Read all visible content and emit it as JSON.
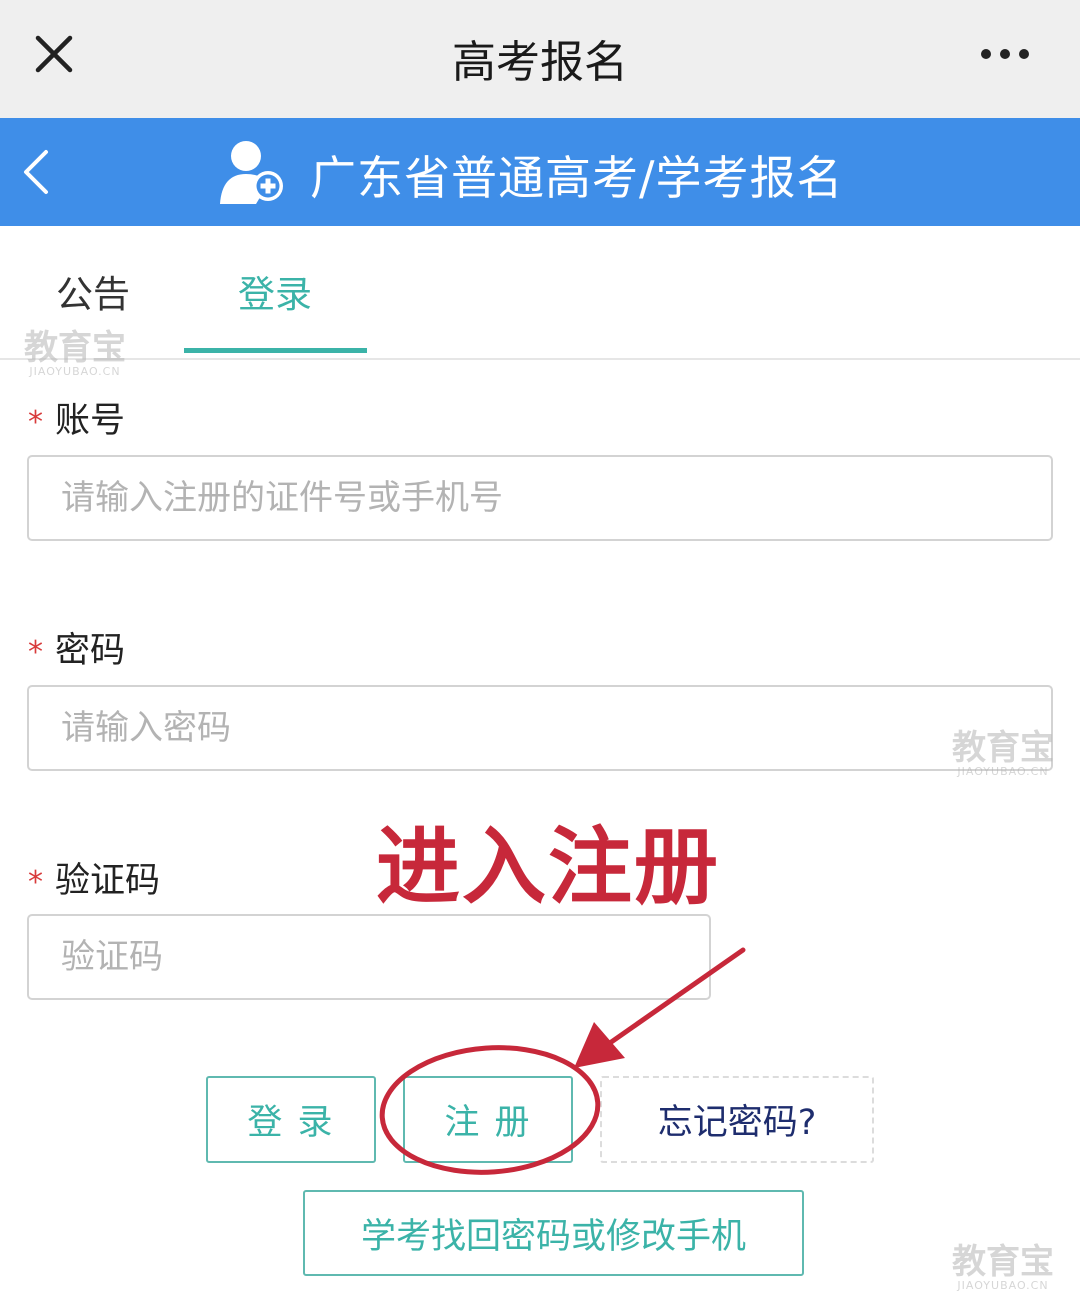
{
  "topbar": {
    "title": "高考报名",
    "close_icon": "close-icon",
    "more_icon": "more-icon"
  },
  "header": {
    "title": "广东省普通高考/学考报名",
    "back_icon": "chevron-left-icon",
    "logo_icon": "add-user-icon",
    "color": "#3f8ee8"
  },
  "tabs": [
    {
      "label": "公告",
      "active": false
    },
    {
      "label": "登录",
      "active": true
    }
  ],
  "form": {
    "required_mark": "*",
    "account": {
      "label": "账号",
      "placeholder": "请输入注册的证件号或手机号",
      "value": ""
    },
    "password": {
      "label": "密码",
      "placeholder": "请输入密码",
      "value": ""
    },
    "captcha": {
      "label": "验证码",
      "placeholder": "验证码",
      "value": ""
    }
  },
  "buttons": {
    "login": "登 录",
    "register": "注 册",
    "forgot": "忘记密码?",
    "recover": "学考找回密码或修改手机"
  },
  "annotation": {
    "text": "进入注册",
    "color": "#c7283a"
  },
  "watermark": {
    "text": "教育宝",
    "domain": "JIAOYUBAO.CN"
  },
  "accent_color": "#3bb3a8"
}
